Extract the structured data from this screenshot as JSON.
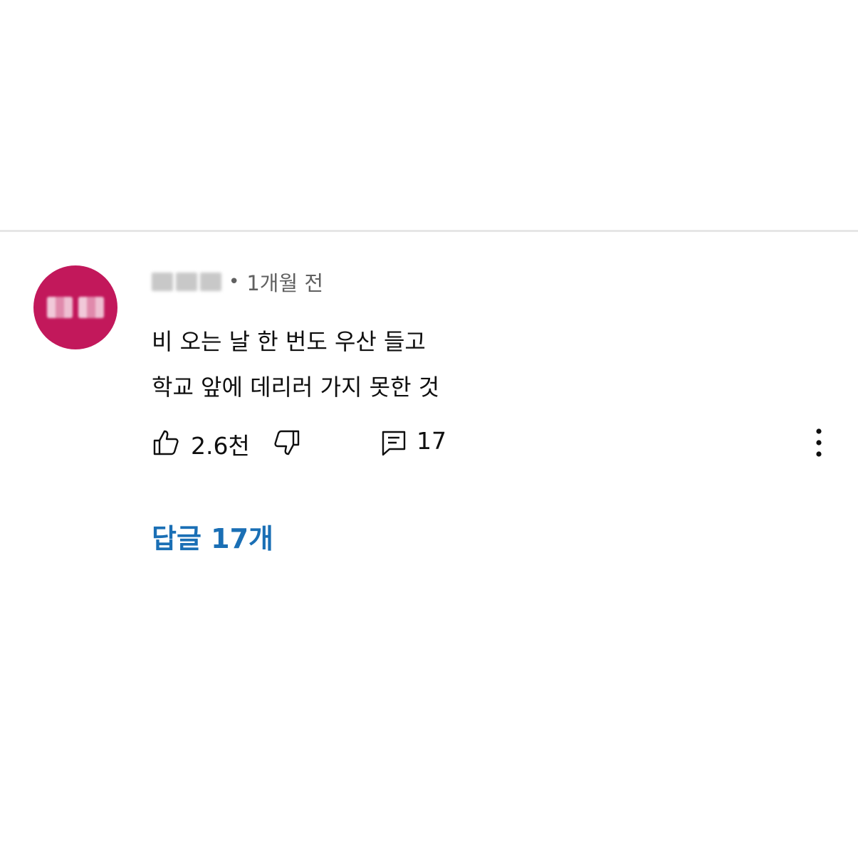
{
  "comment": {
    "timestamp": "1개월 전",
    "separator": "•",
    "text_line1": "비 오는 날 한 번도 우산 들고",
    "text_line2": "학교 앞에 데리러 가지 못한 것",
    "like_count": "2.6천",
    "reply_count": "17",
    "replies_link": "답글 17개"
  },
  "colors": {
    "avatar_bg": "#c2185b",
    "link": "#1a6fb5",
    "meta_text": "#606060"
  },
  "icons": [
    "thumbs-up-icon",
    "thumbs-down-icon",
    "reply-icon",
    "more-vert-icon"
  ]
}
